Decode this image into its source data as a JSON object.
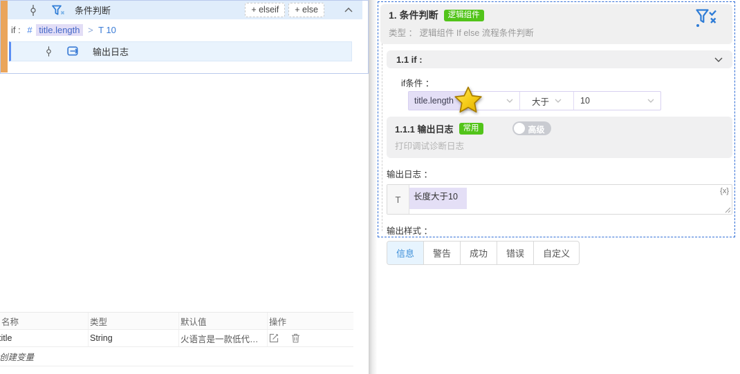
{
  "flow": {
    "header": {
      "title": "条件判断",
      "elseif_label": "+ elseif",
      "else_label": "+ else"
    },
    "if_row": {
      "keyword": "if",
      "colon": ":",
      "hash": "#",
      "field": "title.length",
      "operator": ">",
      "type_marker": "T",
      "value": "10"
    },
    "node": {
      "label": "输出日志"
    }
  },
  "variables": {
    "headers": [
      "名称",
      "类型",
      "默认值",
      "操作"
    ],
    "rows": [
      {
        "name": "title",
        "type": "String",
        "default_value": "火语言是一款低代码..."
      }
    ],
    "create_label": "创建变量"
  },
  "inspector": {
    "header": {
      "title": "1. 条件判断",
      "badge": "逻辑组件",
      "type_line": "类型 ： 逻辑组件 If else 流程条件判断"
    },
    "if_section": {
      "title": "1.1 if :",
      "cond_label": "if条件 ：",
      "field": "title.length",
      "operator": "大于",
      "value": "10"
    },
    "log_card": {
      "title": "1.1.1 输出日志",
      "badge": "常用",
      "toggle_label": "高级",
      "description": "打印调试诊断日志"
    },
    "log_output": {
      "label": "输出日志 ：",
      "prefix": "T",
      "value": "长度大于10",
      "insert_icon": "{x}"
    },
    "style_section": {
      "label": "输出样式 ：",
      "tabs": [
        "信息",
        "警告",
        "成功",
        "错误",
        "自定义"
      ],
      "active": "信息"
    }
  },
  "colors": {
    "accent_blue": "#2e7cd6",
    "badge_green": "#52c41a",
    "purple_highlight": "#e4dff6",
    "selection_dashed": "#2e6cd6",
    "orange_strip": "#eaa55b"
  }
}
